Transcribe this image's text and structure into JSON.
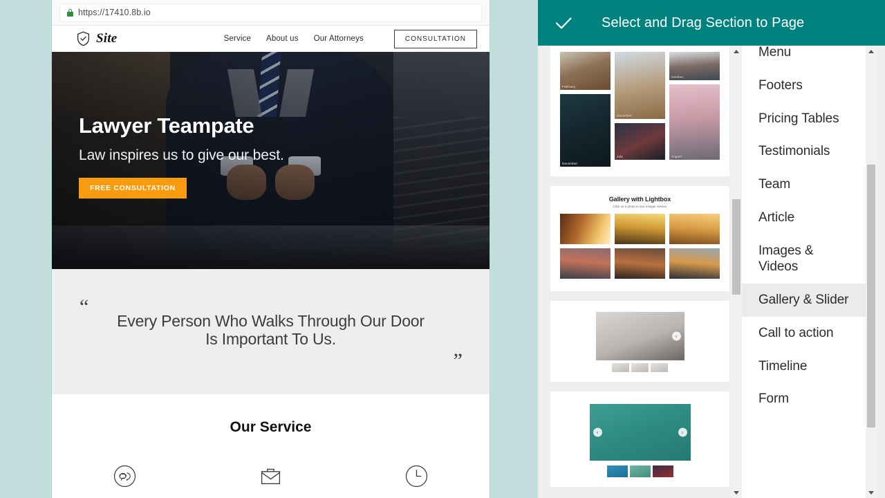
{
  "browser": {
    "url": "https://17410.8b.io",
    "lock_icon": "lock-icon"
  },
  "site": {
    "logo_icon": "shield-check-icon",
    "brand": "Site",
    "nav": [
      {
        "label": "Service"
      },
      {
        "label": "About us"
      },
      {
        "label": "Our Attorneys"
      }
    ],
    "cta": "CONSULTATION",
    "hero": {
      "title": "Lawyer Teampate",
      "subtitle": "Law inspires us to give our best.",
      "button": "FREE CONSULTATION",
      "button_color": "#f99b0c"
    },
    "quote": {
      "open_mark": "“",
      "close_mark": "”",
      "line1": "Every Person Who Walks Through Our Door",
      "line2": "Is Important To Us."
    },
    "services": {
      "heading": "Our Service",
      "icons": [
        {
          "name": "support-headset-icon"
        },
        {
          "name": "briefcase-icon"
        },
        {
          "name": "clock-icon"
        }
      ]
    }
  },
  "panel": {
    "accent_color": "#00827f",
    "title": "Select and Drag Section to Page",
    "confirm_icon": "checkmark-icon",
    "sections": [
      {
        "type": "masonry-gallery",
        "captions": [
          "February",
          "December",
          "December",
          "July",
          "October",
          "August"
        ]
      },
      {
        "type": "lightbox-gallery",
        "heading": "Gallery with Lightbox",
        "subheading": "Click on a photo to see a larger version"
      },
      {
        "type": "slider-with-thumbnails",
        "next_arrow": "›"
      },
      {
        "type": "carousel-with-thumbnails",
        "prev_arrow": "‹",
        "next_arrow": "›"
      }
    ],
    "categories": [
      {
        "label": "Menu",
        "selected": false
      },
      {
        "label": "Footers",
        "selected": false
      },
      {
        "label": "Pricing Tables",
        "selected": false
      },
      {
        "label": "Testimonials",
        "selected": false
      },
      {
        "label": "Team",
        "selected": false
      },
      {
        "label": "Article",
        "selected": false
      },
      {
        "label": "Images & Videos",
        "selected": false
      },
      {
        "label": "Gallery & Slider",
        "selected": true
      },
      {
        "label": "Call to action",
        "selected": false
      },
      {
        "label": "Timeline",
        "selected": false
      },
      {
        "label": "Form",
        "selected": false
      }
    ]
  }
}
